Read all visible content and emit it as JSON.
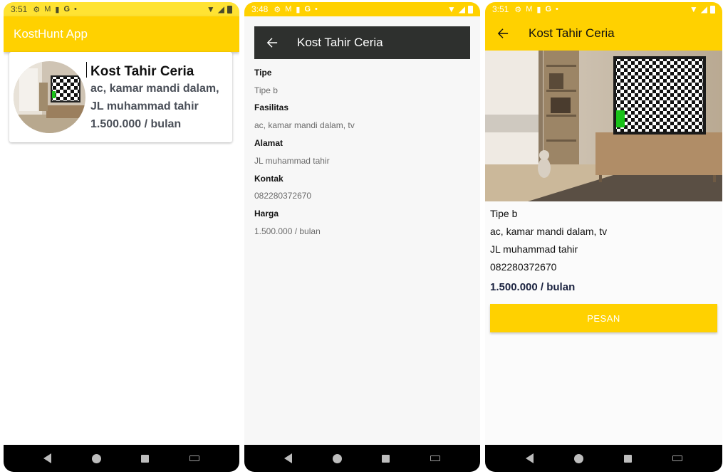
{
  "phone1": {
    "status": {
      "time": "3:51",
      "icons": [
        "gear-icon",
        "gmail-icon",
        "bug-icon",
        "google-icon",
        "dot-icon"
      ]
    },
    "appbar": {
      "title": "KostHunt App"
    },
    "card": {
      "title": "Kost Tahir Ceria",
      "facilities": "ac, kamar mandi dalam,",
      "address": "JL muhammad tahir",
      "price": "1.500.000 / bulan"
    }
  },
  "phone2": {
    "status": {
      "time": "3:48"
    },
    "appbar": {
      "title": "Kost Tahir Ceria"
    },
    "details": [
      {
        "label": "Tipe",
        "value": "Tipe b"
      },
      {
        "label": "Fasilitas",
        "value": "ac, kamar mandi dalam, tv"
      },
      {
        "label": "Alamat",
        "value": "JL muhammad tahir"
      },
      {
        "label": "Kontak",
        "value": "082280372670"
      },
      {
        "label": "Harga",
        "value": "1.500.000 / bulan"
      }
    ]
  },
  "phone3": {
    "status": {
      "time": "3:51"
    },
    "appbar": {
      "title": "Kost Tahir Ceria"
    },
    "type": "Tipe b",
    "facilities": "ac, kamar mandi dalam, tv",
    "address": "JL muhammad tahir",
    "contact": "082280372670",
    "price": "1.500.000 / bulan",
    "button_label": "PESAN"
  },
  "colors": {
    "accent": "#ffd100",
    "appbar_dark": "#2e302e",
    "navbar": "#000000"
  }
}
